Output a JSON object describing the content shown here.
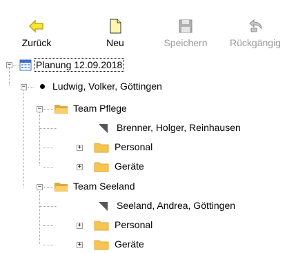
{
  "toolbar": {
    "back_label": "Zurück",
    "new_label": "Neu",
    "save_label": "Speichern",
    "undo_label": "Rückgängig"
  },
  "tree": {
    "root": "Planung 12.09.2018",
    "person": "Ludwig, Volker, Göttingen",
    "team1": "Team Pflege",
    "team1_leader": "Brenner, Holger, Reinhausen",
    "team1_personal": "Personal",
    "team1_geraete": "Geräte",
    "team2": "Team Seeland",
    "team2_leader": "Seeland, Andrea, Göttingen",
    "team2_personal": "Personal",
    "team2_geraete": "Geräte"
  },
  "colors": {
    "accent_back": "#d8b400",
    "folder": "#f5c451",
    "disabled_text": "#9a9a9a"
  }
}
